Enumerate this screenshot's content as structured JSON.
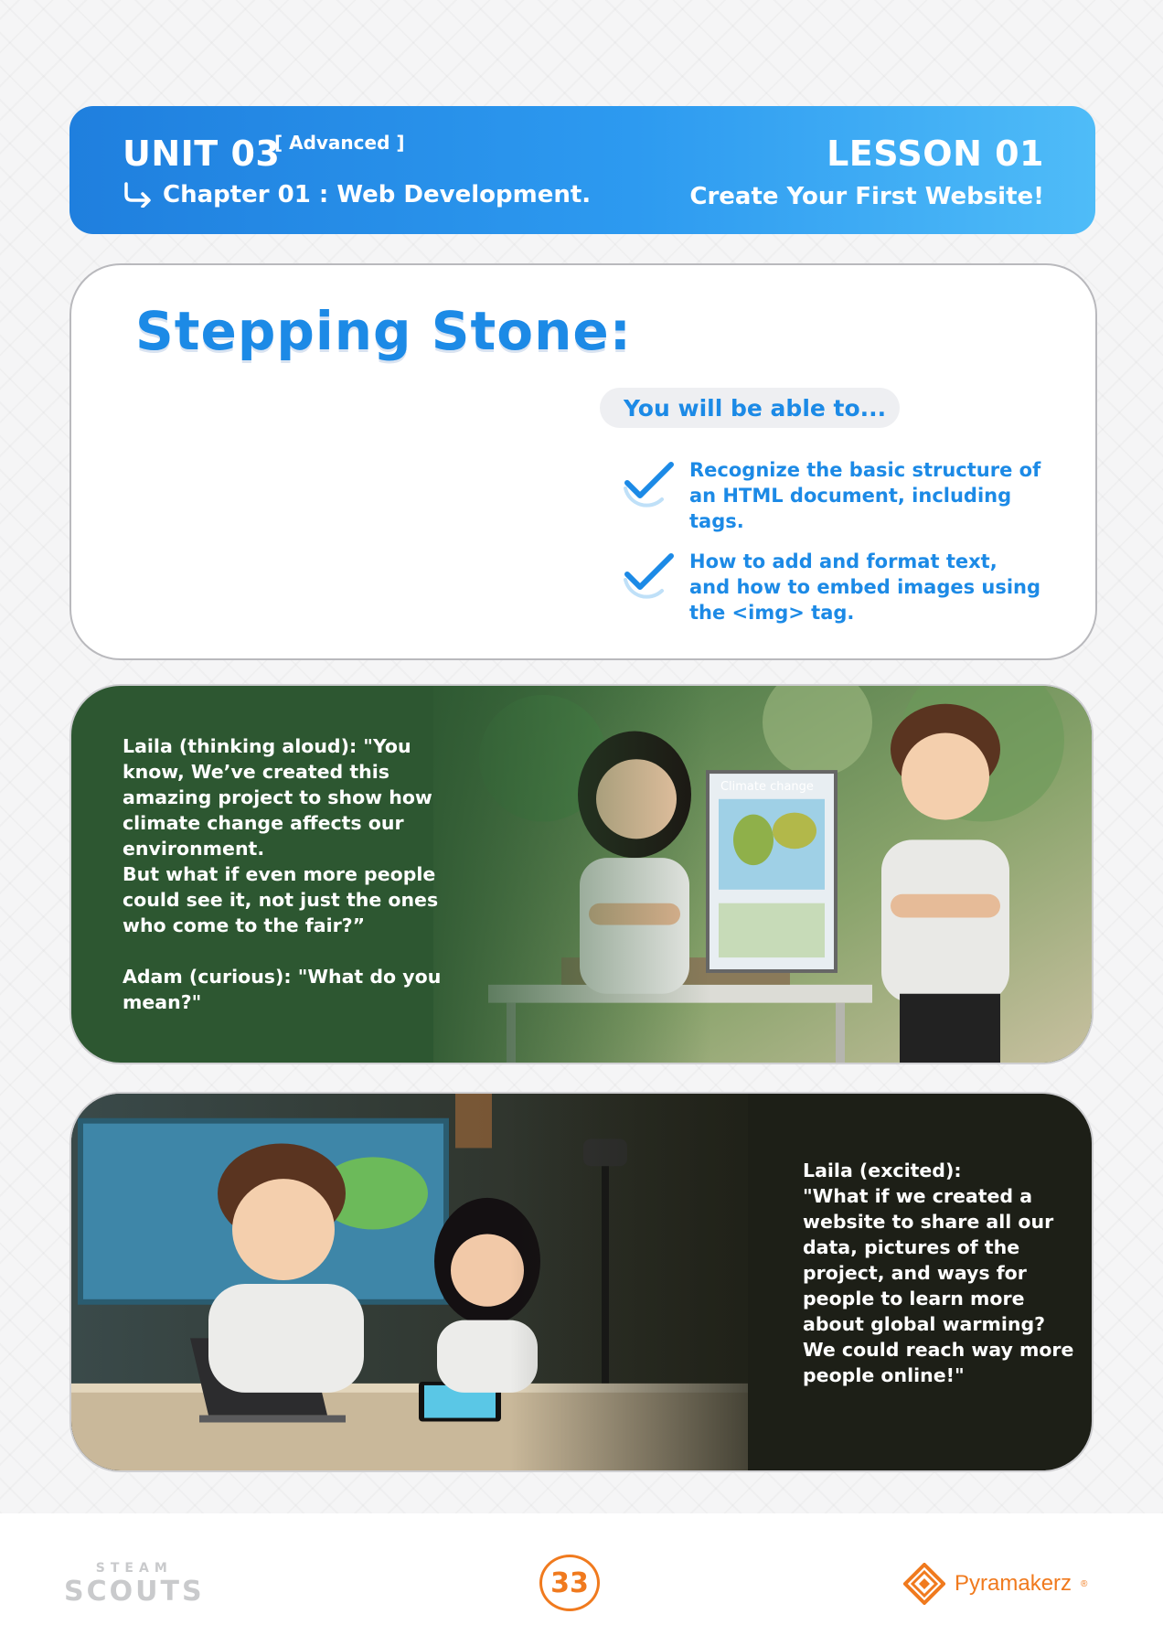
{
  "header": {
    "unit": "UNIT 03",
    "level": "[ Advanced ]",
    "chapter": "Chapter 01 : Web Development.",
    "lesson": "LESSON 01",
    "lesson_title": "Create Your First Website!"
  },
  "stepping_stone": {
    "title": "Stepping Stone:",
    "intro": "You will be able to...",
    "objectives": [
      "Recognize the basic structure of an HTML document, including tags.",
      "How to add and format text, and how to embed images using the <img> tag."
    ]
  },
  "story": {
    "panel1_text": "Laila (thinking aloud): \"You know, We’ve created this amazing project to show how climate change affects our environment.\nBut what if even more people could see it, not just the ones who come to the fair?”\n\nAdam (curious): \"What do you mean?\"",
    "panel1_poster": "Climate change",
    "panel2_text": "Laila (excited):\n\"What if we created a website to share all our data, pictures of the project, and ways for people to learn more about global warming? We could reach way more people online!\""
  },
  "footer": {
    "brand_left_top": "STEAM",
    "brand_left_bottom": "SCOUTS",
    "page_number": "33",
    "brand_right": "Pyramakerz",
    "brand_right_mark": "®"
  },
  "colors": {
    "header_gradient_start": "#1f7fde",
    "header_gradient_end": "#4fbcf8",
    "accent_blue": "#1c8ae6",
    "panel1_bg": "#2d5731",
    "panel2_bg": "#1d1f17",
    "orange": "#f07a1e"
  },
  "icons": [
    "arrow-return-icon",
    "checkmark-icon",
    "pyramakerz-logo-icon"
  ]
}
